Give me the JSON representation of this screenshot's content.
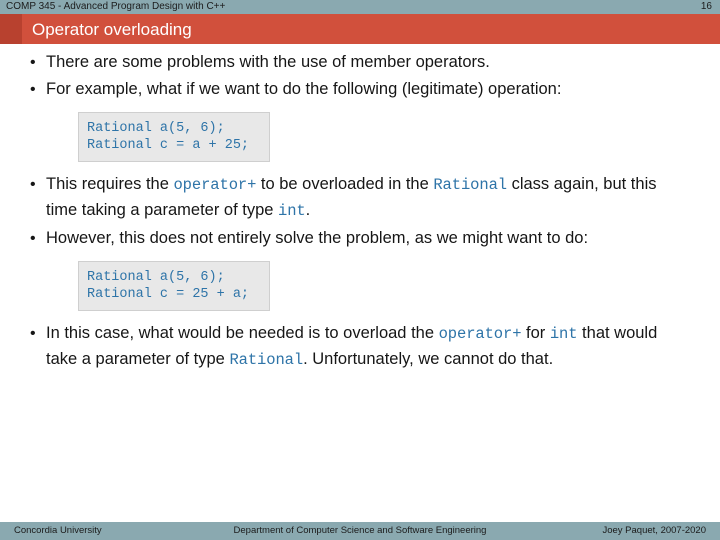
{
  "header": {
    "course": "COMP 345 - Advanced Program Design with C++",
    "page_number": "16"
  },
  "title": {
    "text": "Operator overloading"
  },
  "colors": {
    "header_band": "#8aa9b0",
    "title_band": "#d1503c",
    "title_accent": "#b8412f",
    "code_text": "#2e74a8",
    "code_background": "#e8e8e8"
  },
  "bullets": {
    "b1": {
      "marker": "•",
      "text": "There are some problems with the use of member operators."
    },
    "b2": {
      "marker": "•",
      "text": "For example, what if we want to do the following (legitimate) operation:"
    },
    "b3": {
      "marker": "•",
      "part1": "This requires the ",
      "code1": "operator+",
      "part2": " to be overloaded in the ",
      "code2": "Rational",
      "part3": " class again, but this time taking a parameter of type ",
      "code3": "int",
      "part4": "."
    },
    "b4": {
      "marker": "•",
      "text": "However, this does not entirely solve the problem, as we might want to do:"
    },
    "b5": {
      "marker": "•",
      "part1": "In this case, what would be needed is to overload the ",
      "code1": "operator+",
      "part2": " for ",
      "code2": "int",
      "part3": " that would take a parameter of type ",
      "code3": "Rational",
      "part4": ". Unfortunately, we cannot do that."
    }
  },
  "code_blocks": {
    "block1": {
      "line1": "Rational a(5, 6);",
      "line2": "Rational c = a + 25;"
    },
    "block2": {
      "line1": "Rational a(5, 6);",
      "line2": "Rational c = 25 + a;"
    }
  },
  "footer": {
    "left": "Concordia University",
    "center": "Department of Computer Science and Software Engineering",
    "right": "Joey Paquet, 2007-2020"
  }
}
